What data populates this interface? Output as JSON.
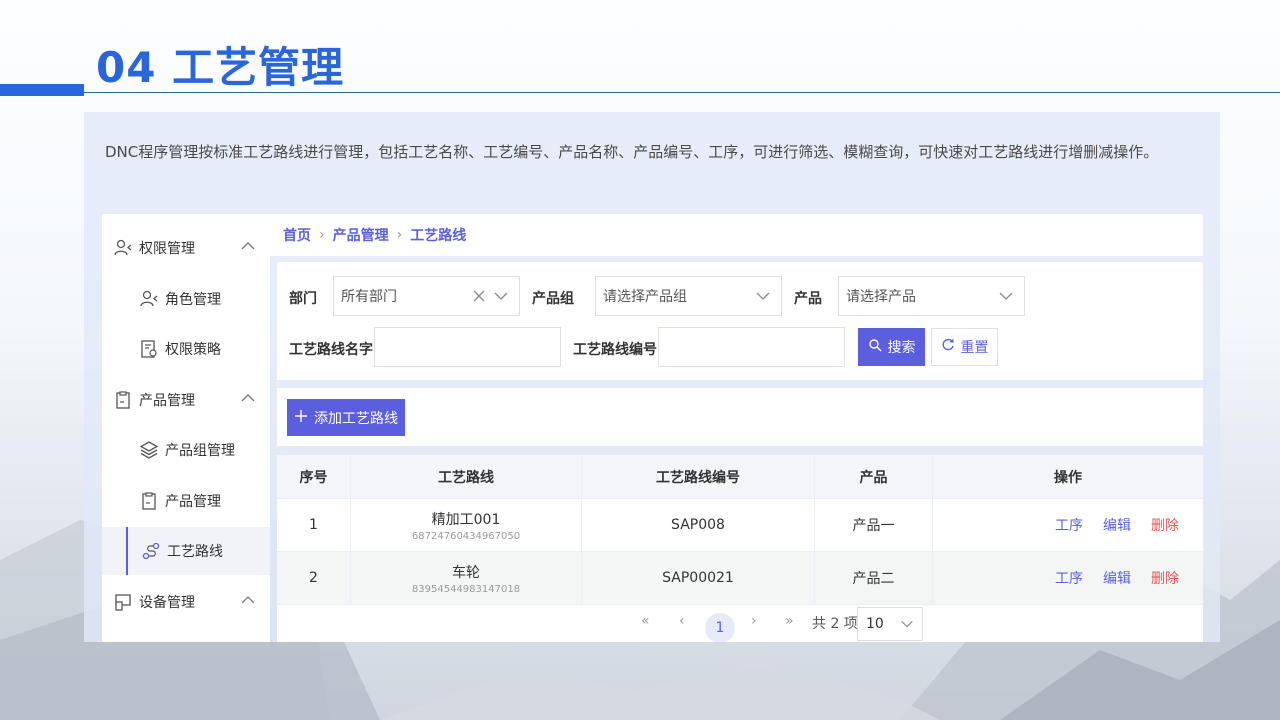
{
  "slide": {
    "title": "04 工艺管理",
    "intro": "DNC程序管理按标准工艺路线进行管理，包括工艺名称、工艺编号、产品名称、产品编号、工序，可进行筛选、模糊查询，可快速对工艺路线进行增删减操作。"
  },
  "sidebar": {
    "items": [
      {
        "label": "权限管理",
        "icon": "user-permission-icon",
        "type": "group",
        "expanded": true
      },
      {
        "label": "角色管理",
        "icon": "user-role-icon",
        "type": "sub"
      },
      {
        "label": "权限策略",
        "icon": "policy-document-icon",
        "type": "sub"
      },
      {
        "label": "产品管理",
        "icon": "clipboard-icon",
        "type": "group",
        "expanded": true
      },
      {
        "label": "产品组管理",
        "icon": "layers-icon",
        "type": "sub"
      },
      {
        "label": "产品管理",
        "icon": "clipboard-icon",
        "type": "sub"
      },
      {
        "label": "工艺路线",
        "icon": "route-icon",
        "type": "sub",
        "active": true
      },
      {
        "label": "设备管理",
        "icon": "device-icon",
        "type": "group",
        "expanded": true
      }
    ]
  },
  "breadcrumb": [
    "首页",
    "产品管理",
    "工艺路线"
  ],
  "filters": {
    "dept_label": "部门",
    "dept_value": "所有部门",
    "group_label": "产品组",
    "group_placeholder": "请选择产品组",
    "product_label": "产品",
    "product_placeholder": "请选择产品",
    "route_name_label": "工艺路线名字",
    "route_code_label": "工艺路线编号",
    "search_label": "搜索",
    "reset_label": "重置"
  },
  "actions": {
    "add_label": "添加工艺路线"
  },
  "table": {
    "headers": [
      "序号",
      "工艺路线",
      "工艺路线编号",
      "产品",
      "操作"
    ],
    "rows": [
      {
        "index": "1",
        "route": "精加工001",
        "route_id": "68724760434967050",
        "code": "SAP008",
        "product": "产品一"
      },
      {
        "index": "2",
        "route": "车轮",
        "route_id": "83954544983147018",
        "code": "SAP00021",
        "product": "产品二"
      }
    ],
    "ops": {
      "process": "工序",
      "edit": "编辑",
      "delete": "删除"
    }
  },
  "pager": {
    "current": "1",
    "total": "共 2 项",
    "page_size": "10"
  },
  "colors": {
    "accent": "#5b5fdd",
    "title_blue": "#2a66d9",
    "danger": "#e05757"
  }
}
